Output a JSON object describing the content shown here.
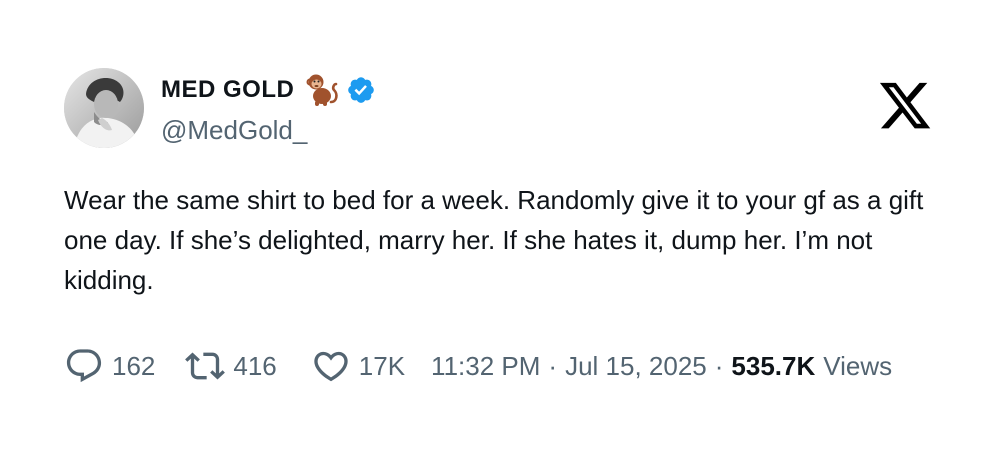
{
  "author": {
    "display_name": "MED GOLD",
    "handle": "@MedGold_",
    "name_emoji": "monkey-icon",
    "verified_color": "#1d9bf0"
  },
  "tweet": {
    "text": "Wear the same shirt to bed for a week. Randomly give it to your gf as a gift one day. If she’s delighted, marry her. If she hates it, dump her. I’m not kidding."
  },
  "metrics": {
    "replies": "162",
    "retweets": "416",
    "likes": "17K"
  },
  "meta": {
    "time": "11:32 PM",
    "separator": "·",
    "date": "Jul 15, 2025",
    "views_count": "535.7K",
    "views_label": "Views"
  },
  "colors": {
    "text_primary": "#0f1419",
    "text_secondary": "#536471",
    "accent": "#1d9bf0"
  }
}
